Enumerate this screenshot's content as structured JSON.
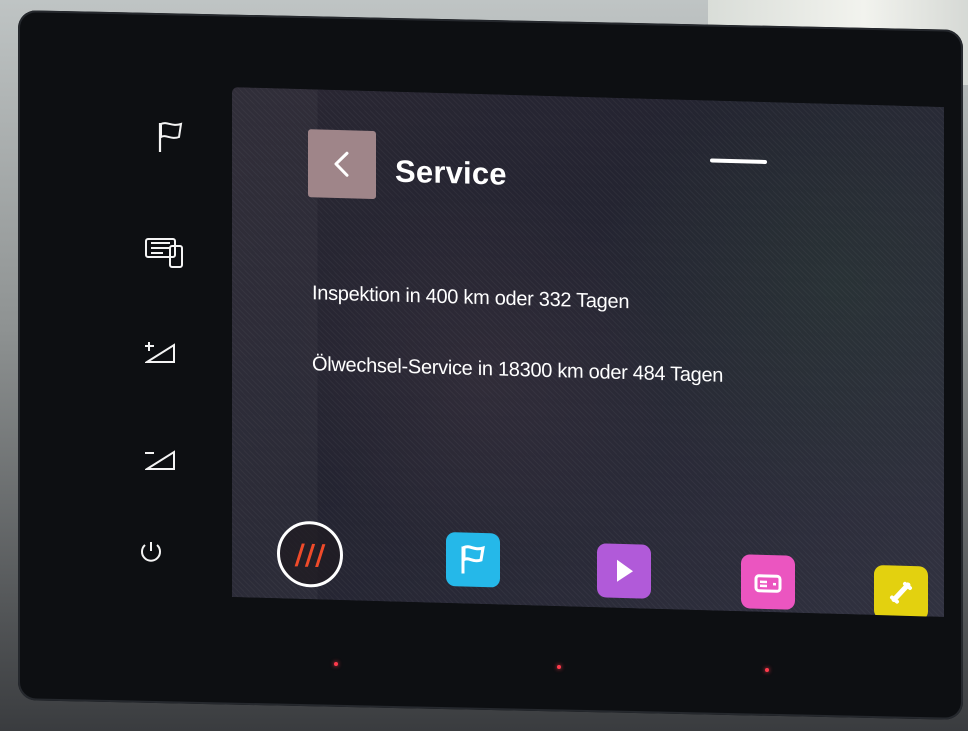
{
  "screen": {
    "title": "Service",
    "back_icon": "chevron-left-icon",
    "service_lines": [
      "Inspektion in 400 km oder 332 Tagen",
      "Ölwechsel-Service in 18300 km oder 484 Tagen"
    ]
  },
  "side_controls": {
    "icons": [
      "flag-icon",
      "phone-screen-icon",
      "volume-up-icon",
      "volume-down-icon",
      "power-icon"
    ]
  },
  "bottom_bar": {
    "menu_symbol": "///",
    "buttons": [
      {
        "name": "menu-button",
        "icon": "menu-icon",
        "color": "#ef4b2a"
      },
      {
        "name": "navigation-button",
        "icon": "flag-icon",
        "color": "#25b8e9"
      },
      {
        "name": "media-button",
        "icon": "play-icon",
        "color": "#b15ad9"
      },
      {
        "name": "radio-button",
        "icon": "radio-icon",
        "color": "#eb55c0"
      },
      {
        "name": "phone-button",
        "icon": "phone-icon",
        "color": "#e3d10f"
      }
    ]
  },
  "colors": {
    "back_button": "#9f8589",
    "screen_background": "#2a2733",
    "text": "#ffffff"
  }
}
